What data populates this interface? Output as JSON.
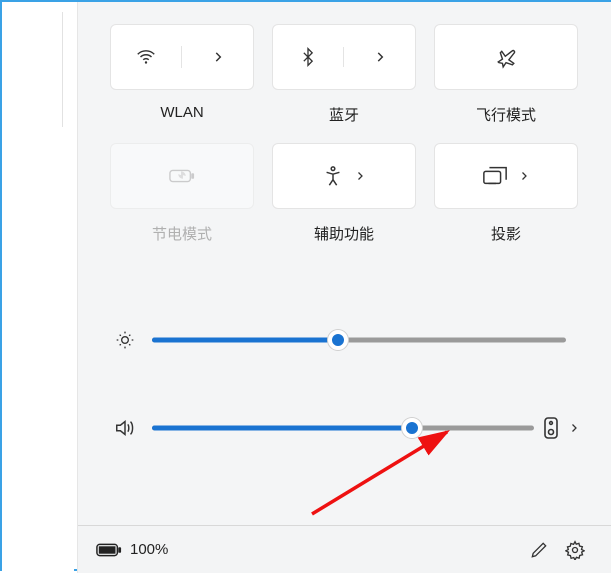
{
  "tiles": [
    {
      "label": "WLAN",
      "split": true,
      "icon": "wifi",
      "disabled": false
    },
    {
      "label": "蓝牙",
      "split": true,
      "icon": "bluetooth",
      "disabled": false
    },
    {
      "label": "飞行模式",
      "split": false,
      "icon": "airplane",
      "disabled": false
    },
    {
      "label": "节电模式",
      "split": false,
      "icon": "battery-saver",
      "disabled": true
    },
    {
      "label": "辅助功能",
      "split": false,
      "icon": "accessibility",
      "chevron": true,
      "disabled": false
    },
    {
      "label": "投影",
      "split": false,
      "icon": "project",
      "chevron": true,
      "disabled": false
    }
  ],
  "sliders": {
    "brightness": {
      "percent": 45
    },
    "volume": {
      "percent": 68
    }
  },
  "footer": {
    "battery_percent": "100%"
  }
}
